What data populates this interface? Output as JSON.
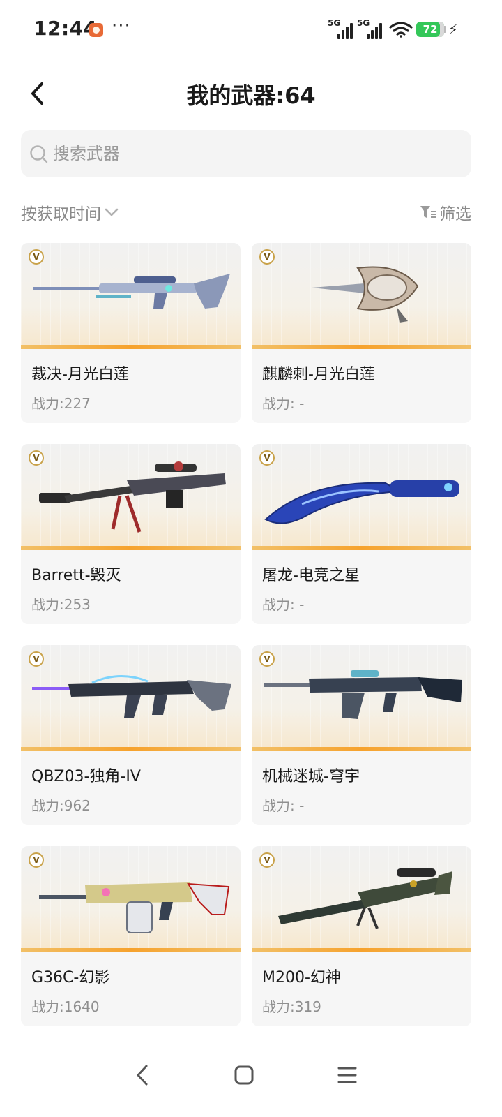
{
  "status_bar": {
    "time": "12:44",
    "more": "···",
    "network_1": "5G",
    "network_2": "5G",
    "battery_level": "72",
    "icons": [
      "app-notification-icon",
      "signal-icon",
      "wifi-icon",
      "battery-icon",
      "charging-icon"
    ]
  },
  "header": {
    "title": "我的武器:64",
    "back_icon": "chevron-left-icon"
  },
  "search": {
    "placeholder": "搜索武器",
    "value": "",
    "icon": "search-icon"
  },
  "toolbar": {
    "sort_label": "按获取时间",
    "filter_label": "筛选"
  },
  "weapons": [
    {
      "name": "裁决-月光白莲",
      "power": "战力:227",
      "badge": "V"
    },
    {
      "name": "麒麟刺-月光白莲",
      "power": "战力: -",
      "badge": "V"
    },
    {
      "name": "Barrett-毁灭",
      "power": "战力:253",
      "badge": "V"
    },
    {
      "name": "屠龙-电竞之星",
      "power": "战力: -",
      "badge": "V"
    },
    {
      "name": "QBZ03-独角-IV",
      "power": "战力:962",
      "badge": "V"
    },
    {
      "name": "机械迷城-穹宇",
      "power": "战力: -",
      "badge": "V"
    },
    {
      "name": "G36C-幻影",
      "power": "战力:1640",
      "badge": "V"
    },
    {
      "name": "M200-幻神",
      "power": "战力:319",
      "badge": "V"
    }
  ],
  "nav_bar": {
    "icons": [
      "back-nav-icon",
      "home-nav-icon",
      "menu-nav-icon"
    ]
  },
  "colors": {
    "accent_bar": "#f6a22d",
    "battery": "#34c759",
    "text_secondary": "#8f8f8f"
  }
}
